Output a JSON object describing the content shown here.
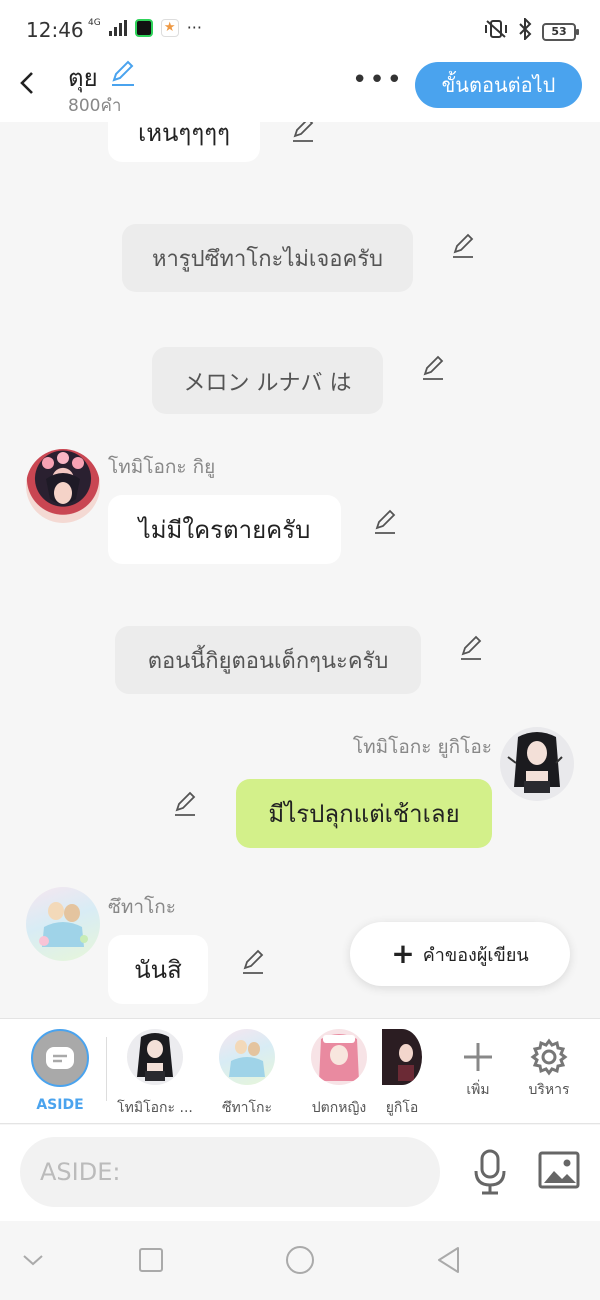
{
  "status": {
    "time": "12:46",
    "network": "4G",
    "battery": "53",
    "more": "···"
  },
  "header": {
    "title": "ตุย",
    "subtitle": "800คำ",
    "more": "•••",
    "next_button": "ขั้นตอนต่อไป"
  },
  "messages": [
    {
      "type": "bubble",
      "text": "เหนๆๆๆๆ"
    },
    {
      "type": "narration",
      "text": "หารูปซึทาโกะไม่เจอครับ"
    },
    {
      "type": "narration",
      "text": "メロン ルナバ は"
    },
    {
      "type": "left",
      "speaker": "โทมิโอกะ กิยู",
      "text": "ไม่มีใครตายครับ"
    },
    {
      "type": "narration",
      "text": "ตอนนี้กิยูตอนเด็กๆนะครับ"
    },
    {
      "type": "right",
      "speaker": "โทมิโอกะ ยูกิโอะ",
      "text": "มีไรปลุกแต่เช้าเลย"
    },
    {
      "type": "left",
      "speaker": "ซึทาโกะ",
      "text": "นันสิ"
    }
  ],
  "fab": {
    "label": "คำของผู้เขียน"
  },
  "characters": [
    {
      "label": "ASIDE"
    },
    {
      "label": "โทมิโอกะ ..."
    },
    {
      "label": "ซึทาโกะ"
    },
    {
      "label": "ปตกหญิง"
    },
    {
      "label": "ยูกิโอ"
    },
    {
      "label": "เพิ่ม"
    },
    {
      "label": "บริหาร"
    }
  ],
  "input": {
    "placeholder": "ASIDE:"
  },
  "colors": {
    "accent": "#4aa3ee",
    "green_bubble": "#d3f08a",
    "narration": "#ececec"
  }
}
